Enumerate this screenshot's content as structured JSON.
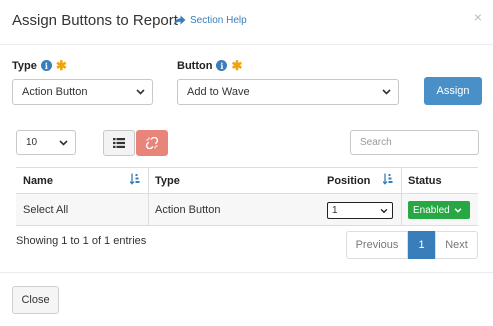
{
  "modal": {
    "title": "Assign Buttons to Report",
    "help_link": "Section Help",
    "close_glyph": "×"
  },
  "form": {
    "type_label": "Type",
    "type_value": "Action Button",
    "button_label": "Button",
    "button_value": "Add to Wave",
    "assign_label": "Assign",
    "required_glyph": "✱",
    "info_glyph": "i"
  },
  "toolbar": {
    "page_length": "10",
    "search_placeholder": "Search",
    "list_icon": "list-icon",
    "unlink_icon": "unlink-icon"
  },
  "table": {
    "columns": [
      "Name",
      "Type",
      "Position",
      "Status"
    ],
    "rows": [
      {
        "name": "Select All",
        "type": "Action Button",
        "position": "1",
        "status": "Enabled"
      }
    ]
  },
  "pagination": {
    "info": "Showing 1 to 1 of 1 entries",
    "previous": "Previous",
    "current": "1",
    "next": "Next"
  },
  "footer": {
    "close_label": "Close"
  },
  "colors": {
    "primary": "#3a7dbb",
    "assign_button": "#4a90c8",
    "required_star": "#f0a30a",
    "status_enabled": "#28a745",
    "unlink_button": "#e8847a"
  }
}
